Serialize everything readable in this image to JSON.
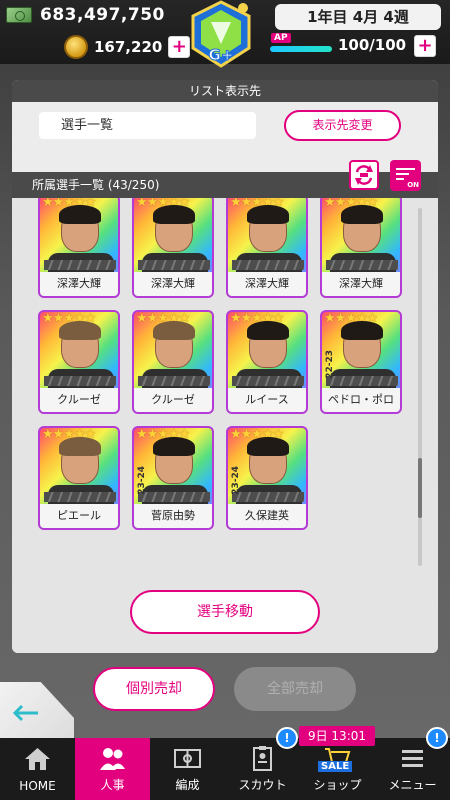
{
  "header": {
    "money": "683,497,750",
    "coins": "167,220",
    "coin_plus": "+",
    "week": "1年目 4月 4週",
    "ap_label": "AP",
    "ap_fraction": 1.0,
    "ap_text": "100/100",
    "ap_plus": "+",
    "rank": "G+"
  },
  "panel": {
    "list_target_title": "リスト表示先",
    "list_target_value": "選手一覧",
    "change_button": "表示先変更",
    "roster_title": "所属選手一覧 (43/250)",
    "filter_badge": "ON"
  },
  "cards": [
    {
      "name": "深澤大輝",
      "season": ""
    },
    {
      "name": "深澤大輝",
      "season": ""
    },
    {
      "name": "深澤大輝",
      "season": ""
    },
    {
      "name": "深澤大輝",
      "season": ""
    },
    {
      "name": "クルーゼ",
      "season": ""
    },
    {
      "name": "クルーゼ",
      "season": ""
    },
    {
      "name": "ルイース",
      "season": ""
    },
    {
      "name": "ペドロ・ポロ",
      "season": "22-23"
    },
    {
      "name": "ピエール",
      "season": ""
    },
    {
      "name": "菅原由勢",
      "season": "23-24"
    },
    {
      "name": "久保建英",
      "season": "23-24"
    }
  ],
  "actions": {
    "move": "選手移動",
    "individual_sell": "個別売却",
    "sell_all": "全部売却"
  },
  "nav": {
    "home": "HOME",
    "personnel": "人事",
    "formation": "編成",
    "scout": "スカウト",
    "shop": "ショップ",
    "menu": "メニュー",
    "scout_badge": "!",
    "menu_badge": "!",
    "shop_time": "9日 13:01",
    "sale": "SALE"
  }
}
